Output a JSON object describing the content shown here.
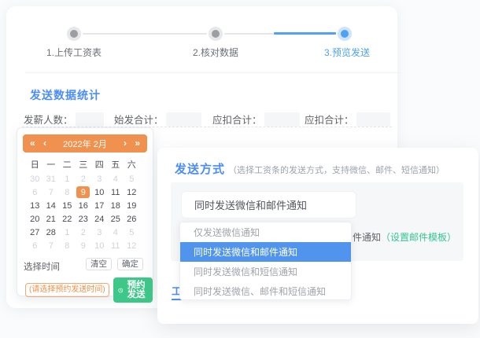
{
  "stepper": {
    "steps": [
      {
        "label": "1.上传工资表",
        "state": "done"
      },
      {
        "label": "2.核对数据",
        "state": "done"
      },
      {
        "label": "3.预览发送",
        "state": "active"
      }
    ]
  },
  "stats": {
    "title": "发送数据统计",
    "items": [
      {
        "label": "发薪人数：",
        "value": ""
      },
      {
        "label": "始发合计：",
        "value": ""
      },
      {
        "label": "应扣合计：",
        "value": ""
      },
      {
        "label": "应扣合计：",
        "value": ""
      }
    ]
  },
  "calendar": {
    "prev_year_icon": "«",
    "prev_month_icon": "‹",
    "title": "2022年 2月",
    "next_month_icon": "›",
    "next_year_icon": "»",
    "weekdays": [
      "日",
      "一",
      "二",
      "三",
      "四",
      "五",
      "六"
    ],
    "cells": [
      {
        "d": "30",
        "state": "muted"
      },
      {
        "d": "31",
        "state": "muted"
      },
      {
        "d": "1",
        "state": "muted"
      },
      {
        "d": "2",
        "state": "muted"
      },
      {
        "d": "3",
        "state": "muted"
      },
      {
        "d": "4",
        "state": "muted"
      },
      {
        "d": "5",
        "state": "muted"
      },
      {
        "d": "6",
        "state": "muted"
      },
      {
        "d": "7",
        "state": "muted"
      },
      {
        "d": "8",
        "state": "muted"
      },
      {
        "d": "9",
        "state": "selected"
      },
      {
        "d": "10",
        "state": "normal"
      },
      {
        "d": "11",
        "state": "normal"
      },
      {
        "d": "12",
        "state": "normal"
      },
      {
        "d": "13",
        "state": "normal"
      },
      {
        "d": "14",
        "state": "normal"
      },
      {
        "d": "15",
        "state": "normal"
      },
      {
        "d": "16",
        "state": "normal"
      },
      {
        "d": "17",
        "state": "normal"
      },
      {
        "d": "18",
        "state": "normal"
      },
      {
        "d": "19",
        "state": "normal"
      },
      {
        "d": "20",
        "state": "normal"
      },
      {
        "d": "21",
        "state": "normal"
      },
      {
        "d": "22",
        "state": "normal"
      },
      {
        "d": "23",
        "state": "normal"
      },
      {
        "d": "24",
        "state": "normal"
      },
      {
        "d": "25",
        "state": "normal"
      },
      {
        "d": "26",
        "state": "normal"
      },
      {
        "d": "27",
        "state": "normal"
      },
      {
        "d": "28",
        "state": "normal"
      },
      {
        "d": "1",
        "state": "muted"
      },
      {
        "d": "2",
        "state": "muted"
      },
      {
        "d": "3",
        "state": "muted"
      },
      {
        "d": "4",
        "state": "muted"
      },
      {
        "d": "5",
        "state": "muted"
      },
      {
        "d": "6",
        "state": "muted"
      },
      {
        "d": "7",
        "state": "muted"
      },
      {
        "d": "8",
        "state": "muted"
      },
      {
        "d": "9",
        "state": "muted"
      },
      {
        "d": "10",
        "state": "muted"
      },
      {
        "d": "11",
        "state": "muted"
      },
      {
        "d": "12",
        "state": "muted"
      }
    ],
    "footer": {
      "select_time_label": "选择时间",
      "clear_button": "清空",
      "confirm_button": "确定"
    },
    "schedule": {
      "hint": "(请选择预约发送时间)",
      "button": "预约发送"
    }
  },
  "panel": {
    "title": "发送方式",
    "caption": "（选择工资条的发送方式，支持微信、邮件、短信通知）",
    "select_value": "同时发送微信和邮件通知",
    "dropdown": [
      {
        "label": "仅发送微信通知",
        "selected": false
      },
      {
        "label": "同时发送微信和邮件通知",
        "selected": true
      },
      {
        "label": "同时发送微信和短信通知",
        "selected": false
      },
      {
        "label": "同时发送微信、邮件和短信通知",
        "selected": false
      }
    ],
    "covered_text": {
      "gray": "件通知",
      "green": "（设置邮件模板）"
    },
    "partial_heading": "工"
  },
  "colors": {
    "accent_blue": "#4b8df8",
    "step_blue": "#4da2f6",
    "selected_row_blue": "#5094ee",
    "accent_orange": "#f0914f",
    "accent_green": "#3dc788",
    "link_green": "#35c690"
  }
}
